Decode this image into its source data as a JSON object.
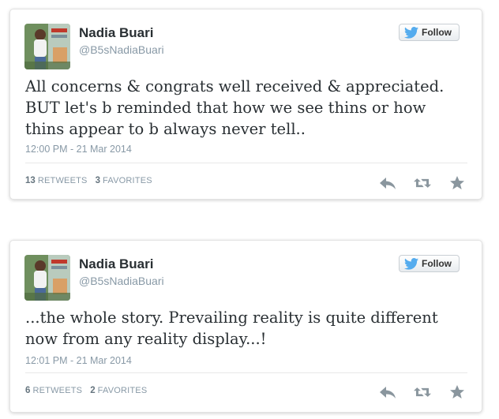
{
  "tweets": [
    {
      "display_name": "Nadia Buari",
      "screen_name": "@B5sNadiaBuari",
      "follow_label": "Follow",
      "text": "All concerns & congrats well received & appreciated. BUT let's b reminded that how we see thins or how thins appear to b always never tell..",
      "timestamp": "12:00 PM - 21 Mar 2014",
      "retweets_count": "13",
      "retweets_label": "RETWEETS",
      "favorites_count": "3",
      "favorites_label": "FAVORITES"
    },
    {
      "display_name": "Nadia Buari",
      "screen_name": "@B5sNadiaBuari",
      "follow_label": "Follow",
      "text": "...the whole story. Prevailing reality is quite different now from any reality display...!",
      "timestamp": "12:01 PM - 21 Mar 2014",
      "retweets_count": "6",
      "retweets_label": "RETWEETS",
      "favorites_count": "2",
      "favorites_label": "FAVORITES"
    }
  ],
  "icons": {
    "brand": "twitter-bird-icon",
    "reply": "reply-icon",
    "retweet": "retweet-icon",
    "favorite": "star-icon"
  },
  "colors": {
    "brand_blue": "#55acee",
    "text": "#292f33",
    "muted": "#8899a6",
    "action_icon": "#8a969e"
  }
}
